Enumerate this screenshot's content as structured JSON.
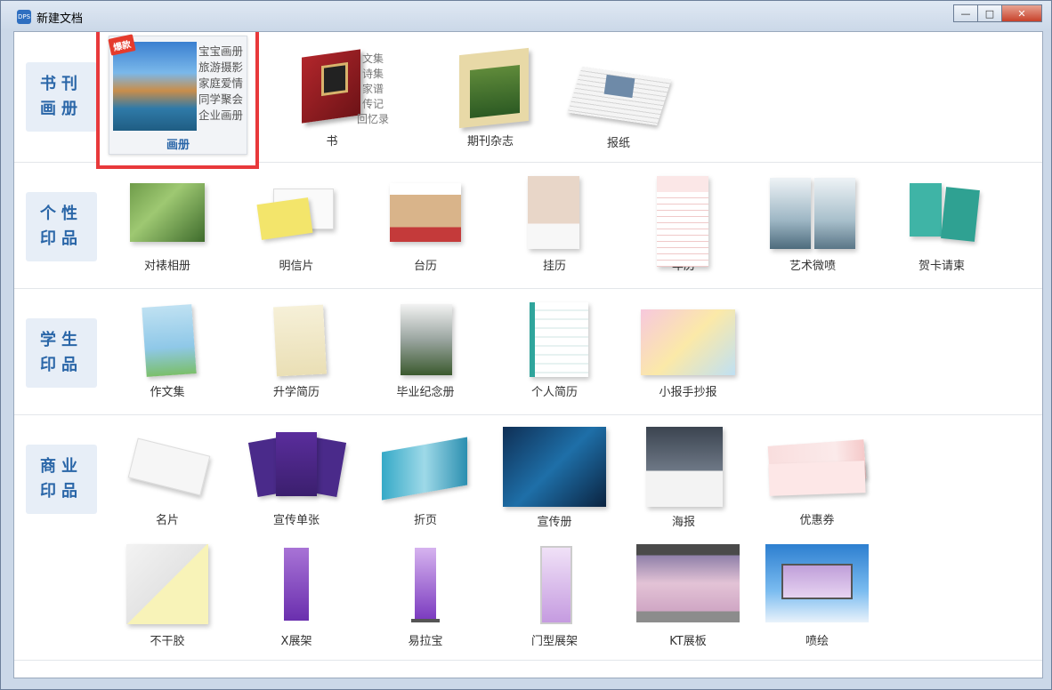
{
  "window": {
    "title": "新建文档",
    "app_icon_text": "DPS",
    "buttons": {
      "minimize": "—",
      "maximize": "□",
      "close": "✕"
    }
  },
  "sections": [
    {
      "label": "书刊\n画册",
      "items": [
        {
          "label": "画册",
          "selected": true,
          "badge": "爆款",
          "tags": [
            "宝宝画册",
            "旅游摄影",
            "家庭爱情",
            "同学聚会",
            "企业画册"
          ]
        },
        {
          "label": "书",
          "tags": [
            "文集",
            "诗集",
            "家谱",
            "传记",
            "回忆录"
          ]
        },
        {
          "label": "期刊杂志"
        },
        {
          "label": "报纸"
        }
      ]
    },
    {
      "label": "个性\n印品",
      "items": [
        {
          "label": "对裱相册"
        },
        {
          "label": "明信片"
        },
        {
          "label": "台历"
        },
        {
          "label": "挂历"
        },
        {
          "label": "年历"
        },
        {
          "label": "艺术微喷"
        },
        {
          "label": "贺卡请柬"
        }
      ]
    },
    {
      "label": "学生\n印品",
      "items": [
        {
          "label": "作文集"
        },
        {
          "label": "升学简历"
        },
        {
          "label": "毕业纪念册"
        },
        {
          "label": "个人简历"
        },
        {
          "label": "小报手抄报"
        }
      ]
    },
    {
      "label": "商业\n印品",
      "items": [
        {
          "label": "名片"
        },
        {
          "label": "宣传单张"
        },
        {
          "label": "折页"
        },
        {
          "label": "宣传册"
        },
        {
          "label": "海报"
        },
        {
          "label": "优惠券"
        },
        {
          "label": "不干胶"
        },
        {
          "label": "X展架"
        },
        {
          "label": "易拉宝"
        },
        {
          "label": "门型展架"
        },
        {
          "label": "KT展板"
        },
        {
          "label": "喷绘"
        }
      ]
    }
  ],
  "colors": {
    "selection_border": "#e8393b",
    "category_text": "#2a66a8",
    "category_bg": "#e7eef7"
  }
}
